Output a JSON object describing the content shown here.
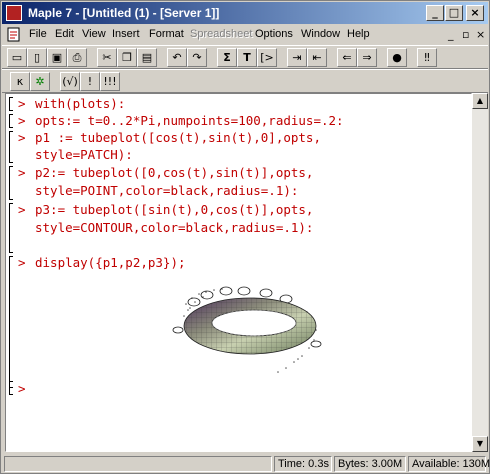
{
  "window": {
    "title": "Maple 7 - [Untitled (1) - [Server 1]]",
    "controls": {
      "minimize": "_",
      "maximize": "□",
      "close": "×"
    }
  },
  "menubar": {
    "items": [
      {
        "label": "File",
        "enabled": true
      },
      {
        "label": "Edit",
        "enabled": true
      },
      {
        "label": "View",
        "enabled": true
      },
      {
        "label": "Insert",
        "enabled": true
      },
      {
        "label": "Format",
        "enabled": true
      },
      {
        "label": "Spreadsheet",
        "enabled": false
      },
      {
        "label": "Options",
        "enabled": true
      },
      {
        "label": "Window",
        "enabled": true
      },
      {
        "label": "Help",
        "enabled": true
      }
    ],
    "doc_controls": {
      "minimize": "_",
      "restore": "▫",
      "close": "×"
    }
  },
  "toolbar1": {
    "buttons": [
      {
        "icon": "new-document-icon",
        "glyph": "▭"
      },
      {
        "icon": "open-folder-icon",
        "glyph": "▯"
      },
      {
        "icon": "save-icon",
        "glyph": "▣"
      },
      {
        "icon": "print-icon",
        "glyph": "⎙"
      },
      {
        "icon": "cut-icon",
        "glyph": "✂"
      },
      {
        "icon": "copy-icon",
        "glyph": "❐"
      },
      {
        "icon": "paste-icon",
        "glyph": "▤"
      },
      {
        "icon": "undo-icon",
        "glyph": "↶"
      },
      {
        "icon": "redo-icon",
        "glyph": "↷"
      },
      {
        "icon": "sigma-icon",
        "glyph": "Σ"
      },
      {
        "icon": "text-T-icon",
        "glyph": "T"
      },
      {
        "icon": "maple-input-icon",
        "glyph": "[>"
      },
      {
        "icon": "indent-icon",
        "glyph": "⇥"
      },
      {
        "icon": "outdent-icon",
        "glyph": "⇤"
      },
      {
        "icon": "arrow-left-icon",
        "glyph": "⇐"
      },
      {
        "icon": "arrow-right-icon",
        "glyph": "⇒"
      },
      {
        "icon": "stop-icon",
        "glyph": "●"
      },
      {
        "icon": "execute-icon",
        "glyph": "‼"
      }
    ]
  },
  "toolbar2": {
    "buttons": [
      {
        "icon": "k-icon",
        "glyph": "κ"
      },
      {
        "icon": "maple-leaf-icon",
        "glyph": "✲"
      },
      {
        "icon": "parentheses-icon",
        "glyph": "(√)"
      },
      {
        "icon": "exclamation-icon",
        "glyph": "!"
      },
      {
        "icon": "double-exclamation-icon",
        "glyph": "!!!"
      }
    ]
  },
  "worksheet": {
    "groups": [
      {
        "lines": [
          "with(plots):"
        ]
      },
      {
        "lines": [
          "opts:= t=0..2*Pi,numpoints=100,radius=.2:"
        ]
      },
      {
        "lines": [
          "p1 := tubeplot([cos(t),sin(t),0],opts,",
          "style=PATCH):"
        ]
      },
      {
        "lines": [
          "p2:= tubeplot([0,cos(t),sin(t)],opts,",
          "style=POINT,color=black,radius=.1):"
        ]
      },
      {
        "lines": [
          "p3:= tubeplot([sin(t),0,cos(t)],opts,",
          "style=CONTOUR,color=black,radius=.1):"
        ]
      },
      {
        "lines": [
          "display({p1,p2,p3});"
        ]
      },
      {
        "lines": [
          ""
        ]
      }
    ],
    "prompt": ">"
  },
  "statusbar": {
    "time": "Time: 0.3s",
    "bytes": "Bytes: 3.00M",
    "available": "Available: 130M"
  }
}
